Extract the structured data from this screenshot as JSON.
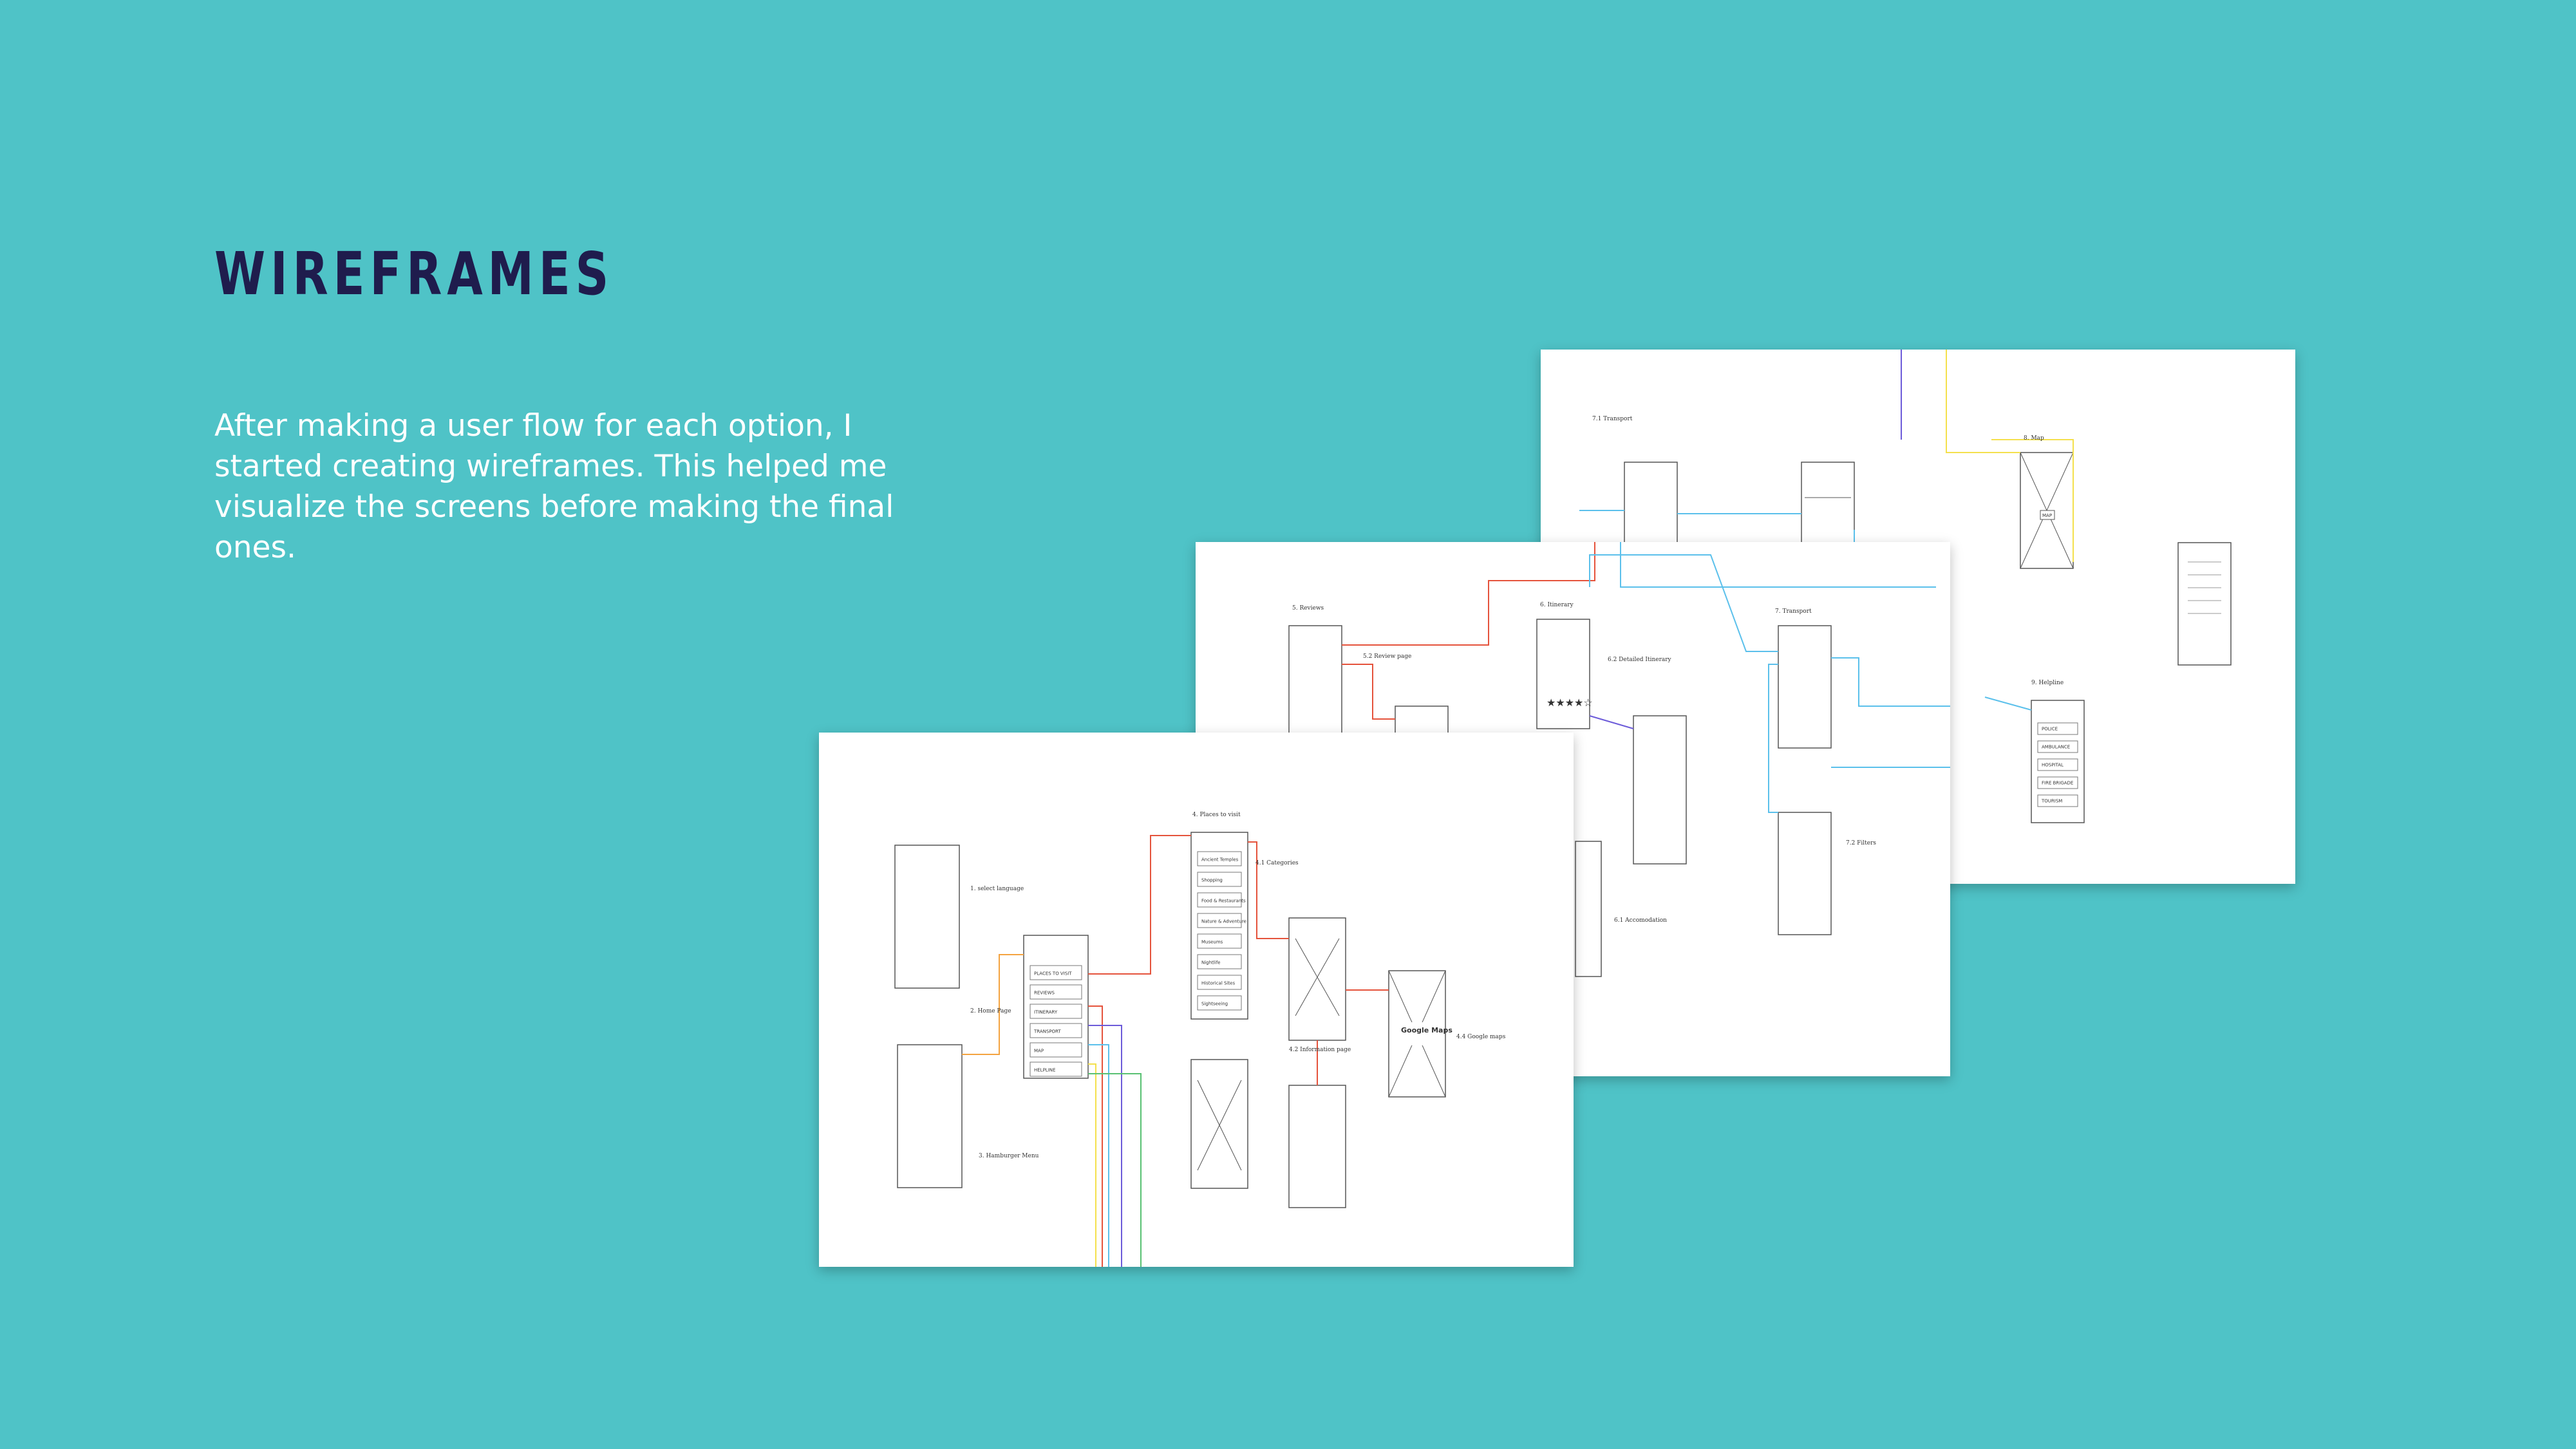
{
  "header": {
    "title": "WIREFRAMES"
  },
  "intro": {
    "text": "After making a user flow for each option, I started creating wireframes. This helped me visualize the screens before making the final ones."
  },
  "colors": {
    "background": "#4FC3C7",
    "title": "#1F1C4D",
    "text": "#FFFFFF",
    "sheet": "#FFFFFF",
    "flow_red": "#E5533C",
    "flow_blue": "#5BC0EB",
    "flow_yellow": "#F4E04D",
    "flow_purple": "#6C5BD9",
    "flow_green": "#59C173"
  },
  "front_sheet": {
    "labels": {
      "select_language": "1. select language",
      "home_page": "2. Home Page",
      "hamburger_menu": "3. Hamburger Menu",
      "places_to_visit": "4. Places to visit",
      "categories": "4.1 Categories",
      "information_page": "4.2 Information page",
      "google_maps_screen": "4.4 Google maps",
      "google_maps": "Google Maps"
    },
    "home_buttons": [
      "PLACES TO VISIT",
      "REVIEWS",
      "ITINERARY",
      "TRANSPORT",
      "MAP",
      "HELPLINE"
    ],
    "places_list": [
      "Ancient Temples",
      "Shopping",
      "Food & Restaurants",
      "Nature & Adventure",
      "Museums",
      "Nightlife",
      "Historical Sites",
      "Sightseeing"
    ]
  },
  "middle_sheet": {
    "labels": {
      "reviews": "5. Reviews",
      "review_page": "5.2 Review page",
      "itinerary": "6. Itinerary",
      "detailed_itinerary": "6.2 Detailed Itinerary",
      "transport": "7. Transport",
      "accommodation": "6.1 Accomodation",
      "filters": "7.2 Filters"
    }
  },
  "back_sheet": {
    "labels": {
      "transport_detail": "7.1 Transport",
      "map": "8. Map",
      "helpline": "9. Helpline",
      "map_box": "MAP"
    },
    "helpline_buttons": [
      "POLICE",
      "AMBULANCE",
      "HOSPITAL",
      "FIRE BRIGADE",
      "TOURISM"
    ]
  }
}
